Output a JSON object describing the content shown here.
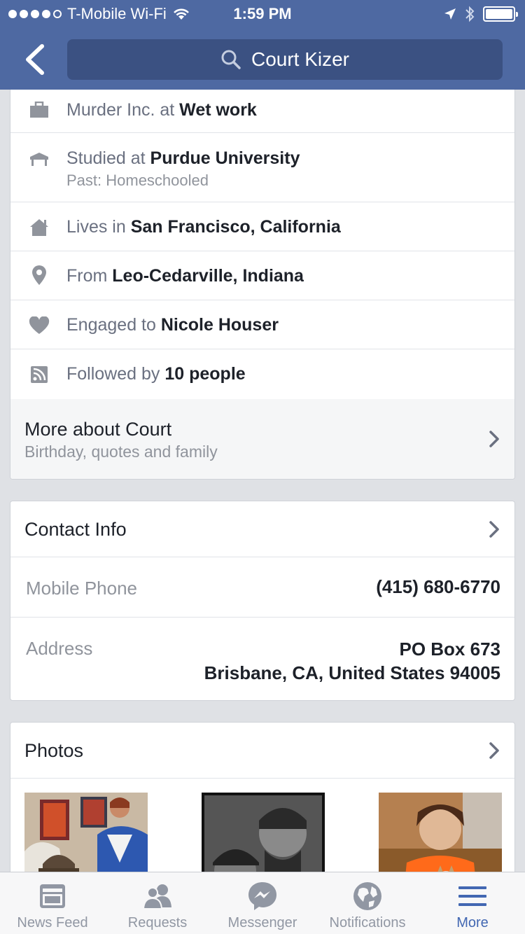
{
  "status_bar": {
    "carrier": "T-Mobile Wi-Fi",
    "time": "1:59 PM"
  },
  "header": {
    "search_text": "Court Kizer"
  },
  "about": {
    "work": {
      "prefix": "Murder Inc. at ",
      "value": "Wet work"
    },
    "education": {
      "prefix": "Studied at ",
      "value": "Purdue University",
      "sub": "Past: Homeschooled"
    },
    "lives": {
      "prefix": "Lives in ",
      "value": "San Francisco, California"
    },
    "from": {
      "prefix": "From ",
      "value": "Leo-Cedarville, Indiana"
    },
    "relationship": {
      "prefix": "Engaged to ",
      "value": "Nicole Houser"
    },
    "followers": {
      "prefix": "Followed by ",
      "value": "10 people"
    },
    "more_title": "More about Court",
    "more_sub": "Birthday, quotes and family"
  },
  "contact": {
    "title": "Contact Info",
    "mobile_label": "Mobile Phone",
    "mobile_value": "(415) 680-6770",
    "address_label": "Address",
    "address_line1": "PO Box 673",
    "address_line2": "Brisbane, CA, United States 94005"
  },
  "photos": {
    "title": "Photos"
  },
  "tabs": [
    {
      "label": "News Feed",
      "icon": "news-feed-icon"
    },
    {
      "label": "Requests",
      "icon": "friend-requests-icon"
    },
    {
      "label": "Messenger",
      "icon": "messenger-icon"
    },
    {
      "label": "Notifications",
      "icon": "globe-icon"
    },
    {
      "label": "More",
      "icon": "menu-icon",
      "active": true
    }
  ],
  "colors": {
    "brand": "#4e69a2",
    "search_bg": "#3b5182",
    "active_tab": "#4267b2"
  }
}
